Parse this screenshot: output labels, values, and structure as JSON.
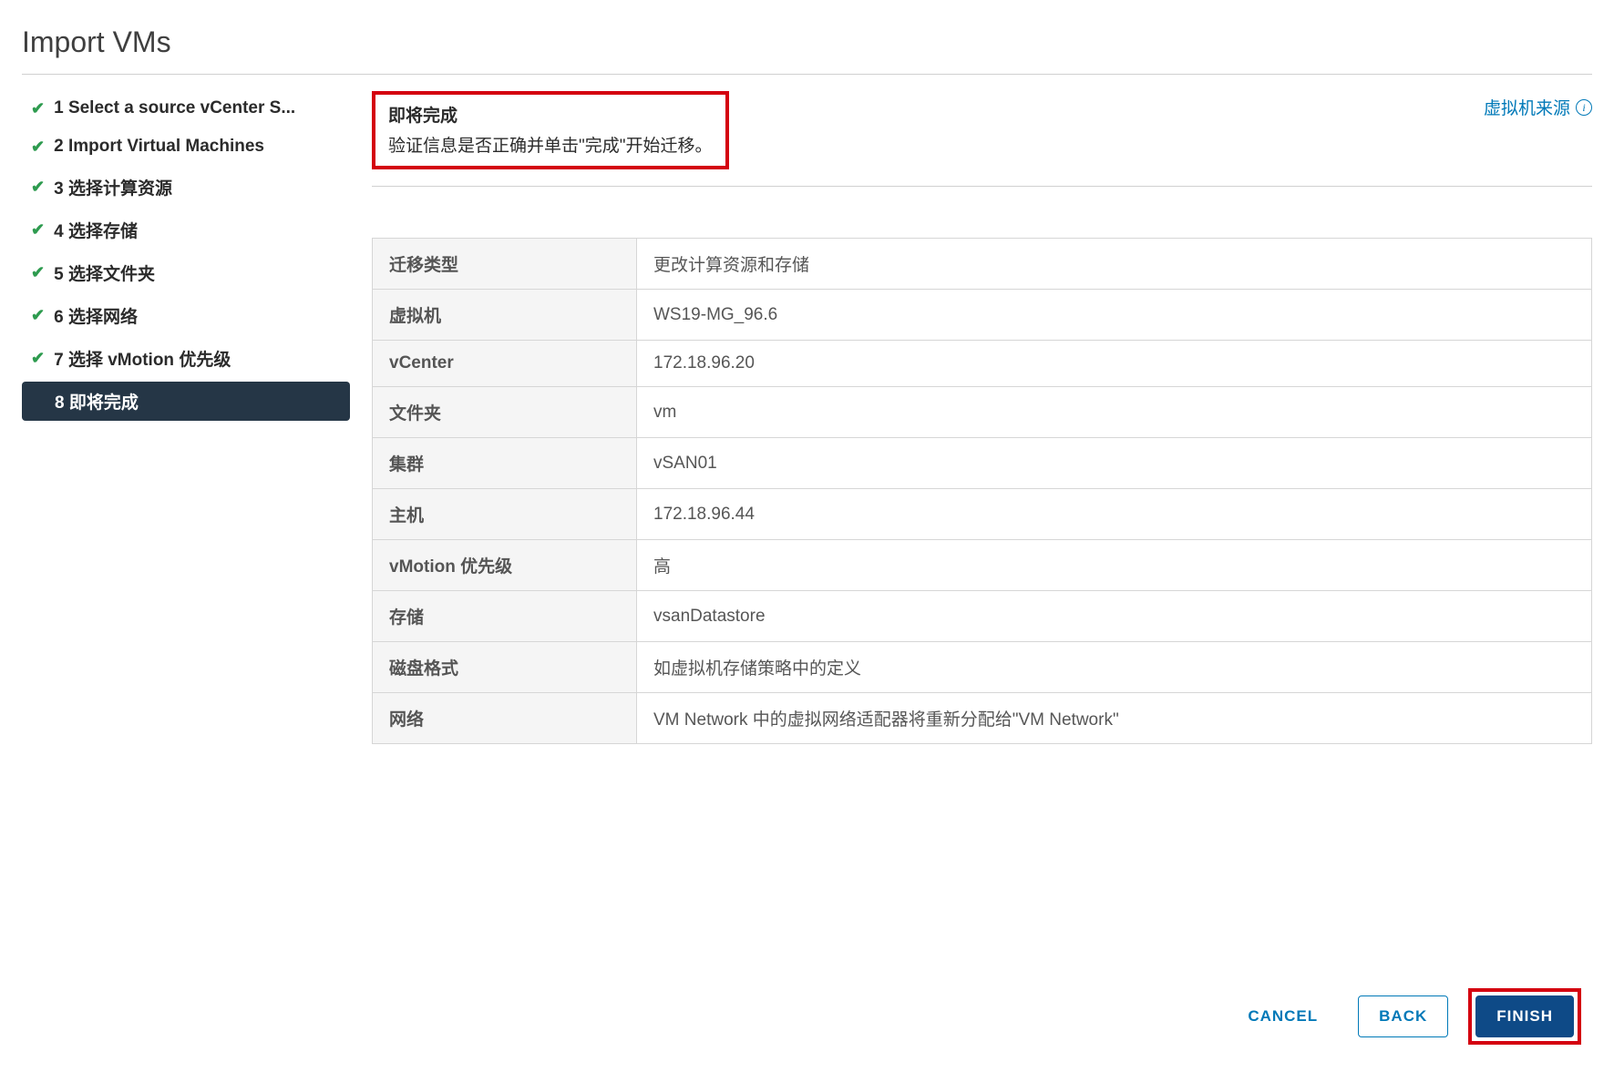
{
  "dialog": {
    "title": "Import VMs"
  },
  "steps": {
    "s1": "1 Select a source vCenter S...",
    "s2": "2 Import Virtual Machines",
    "s3": "3 选择计算资源",
    "s4": "4 选择存储",
    "s5": "5 选择文件夹",
    "s6": "6 选择网络",
    "s7": "7 选择 vMotion 优先级",
    "s8": "8 即将完成"
  },
  "header": {
    "title": "即将完成",
    "subtitle": "验证信息是否正确并单击\"完成\"开始迁移。",
    "source_link": "虚拟机来源"
  },
  "summary": {
    "rows": [
      {
        "k": "迁移类型",
        "v": "更改计算资源和存储"
      },
      {
        "k": "虚拟机",
        "v": "WS19-MG_96.6"
      },
      {
        "k": "vCenter",
        "v": "172.18.96.20"
      },
      {
        "k": "文件夹",
        "v": "vm"
      },
      {
        "k": "集群",
        "v": "vSAN01"
      },
      {
        "k": "主机",
        "v": "172.18.96.44"
      },
      {
        "k": "vMotion 优先级",
        "v": "高"
      },
      {
        "k": "存储",
        "v": "vsanDatastore"
      },
      {
        "k": "磁盘格式",
        "v": "如虚拟机存储策略中的定义"
      },
      {
        "k": "网络",
        "v": "VM Network 中的虚拟网络适配器将重新分配给\"VM Network\""
      }
    ]
  },
  "buttons": {
    "cancel": "CANCEL",
    "back": "BACK",
    "finish": "FINISH"
  }
}
